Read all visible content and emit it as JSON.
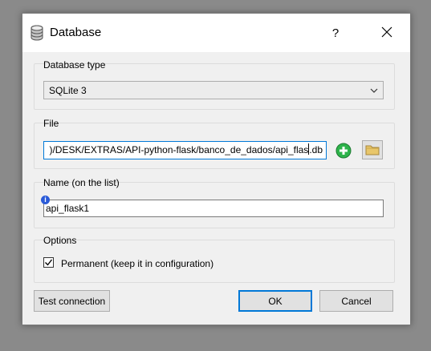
{
  "window": {
    "title": "Database",
    "help_label": "?",
    "title_icon": "database-icon",
    "close_icon": "close-icon"
  },
  "database_type": {
    "label": "Database type",
    "selected": "SQLite 3"
  },
  "file": {
    "label": "File",
    "value_visible": ")/DESK/EXTRAS/API-python-flask/banco_de_dados/api_flas",
    "value_visible_tail": ".db",
    "add_icon": "add-file-icon",
    "browse_icon": "folder-icon"
  },
  "name": {
    "label": "Name (on the list)",
    "value": "api_flask1",
    "info_icon": "info-icon",
    "info_glyph": "i"
  },
  "options": {
    "label": "Options",
    "permanent_label": "Permanent (keep it in configuration)",
    "permanent_checked": true
  },
  "buttons": {
    "test_connection": "Test connection",
    "ok": "OK",
    "cancel": "Cancel"
  },
  "colors": {
    "accent": "#0078d7",
    "add_green": "#2db34a",
    "folder_yellow": "#e8c66a"
  }
}
